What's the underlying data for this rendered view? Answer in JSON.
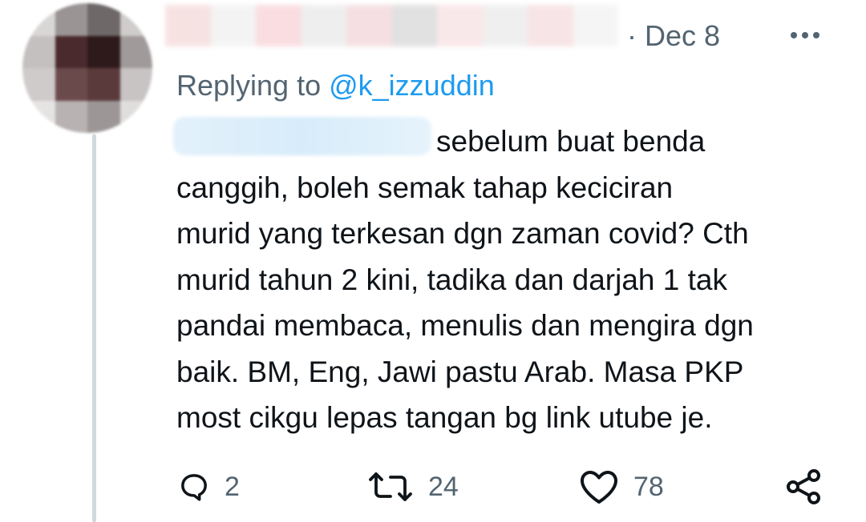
{
  "tweet": {
    "date": "· Dec 8",
    "replying_prefix": "Replying to ",
    "replying_handle": "@k_izzuddin",
    "body_lines": [
      "sebelum buat benda",
      "canggih, boleh semak tahap keciciran",
      "murid yang terkesan dgn zaman covid? Cth",
      "murid tahun 2 kini, tadika dan darjah 1 tak",
      "pandai membaca, menulis dan mengira dgn",
      "baik. BM, Eng, Jawi pastu Arab. Masa PKP",
      "most  cikgu lepas tangan bg link utube je."
    ],
    "actions": {
      "reply_count": "2",
      "retweet_count": "24",
      "like_count": "78"
    }
  },
  "icons": {
    "more": "more-horizontal-icon",
    "reply": "reply-bubble-icon",
    "retweet": "retweet-icon",
    "like": "heart-icon",
    "share": "share-icon"
  },
  "colors": {
    "text": "#0f1419",
    "muted": "#536471",
    "link": "#1d9bf0",
    "thread_line": "#cfd9de"
  }
}
